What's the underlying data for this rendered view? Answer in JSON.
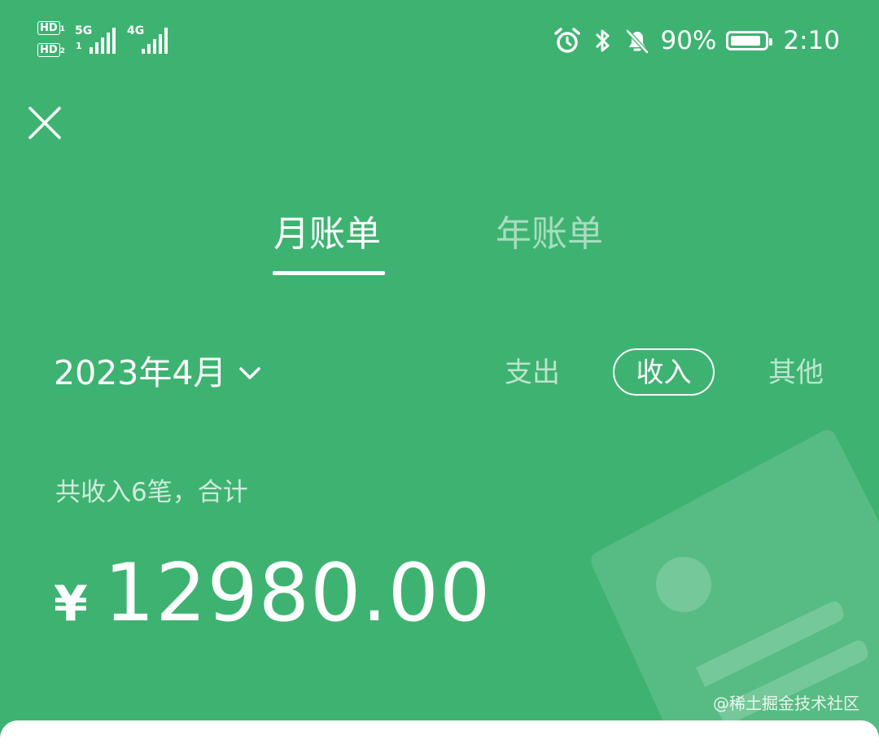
{
  "status_bar": {
    "hd1": "HD",
    "hd1_sub": "1",
    "hd2": "HD",
    "hd2_sub": "2",
    "network1": "5G",
    "network1_sub": "1",
    "network2": "4G",
    "battery_percent": "90%",
    "battery_level": 0.9,
    "time": "2:10",
    "icons": [
      "alarm-icon",
      "bluetooth-icon",
      "bell-muted-icon",
      "battery-icon"
    ]
  },
  "header": {
    "close_icon": "close-icon"
  },
  "tabs": [
    {
      "label": "月账单",
      "active": true
    },
    {
      "label": "年账单",
      "active": false
    }
  ],
  "filter": {
    "month": "2023年4月",
    "month_icon": "chevron-down-icon",
    "types": [
      {
        "label": "支出",
        "selected": false
      },
      {
        "label": "收入",
        "selected": true
      },
      {
        "label": "其他",
        "selected": false
      }
    ]
  },
  "summary": {
    "text": "共收入6笔，合计",
    "currency": "¥",
    "amount": "12980.00"
  },
  "watermark": "@稀土掘金技术社区",
  "colors": {
    "background": "#3eb371",
    "foreground": "#ffffff"
  }
}
